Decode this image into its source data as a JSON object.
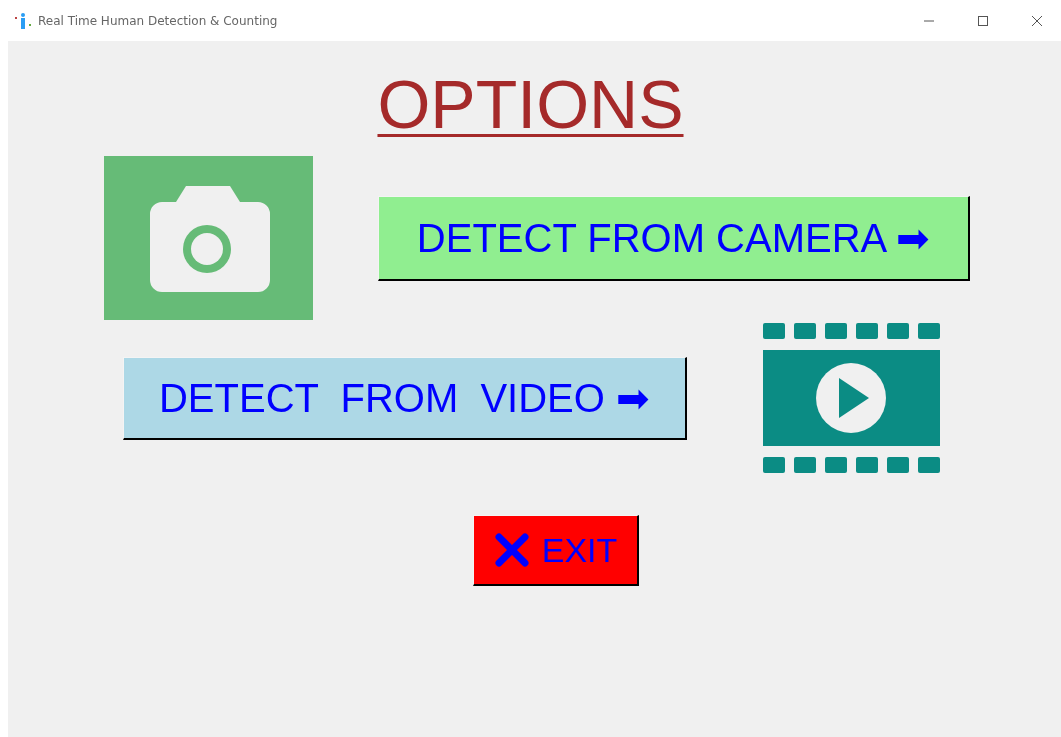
{
  "window": {
    "title": "Real Time Human Detection & Counting"
  },
  "heading": "OPTIONS",
  "buttons": [
    {
      "kind": "camera",
      "label": "DETECT FROM CAMERA ➡"
    },
    {
      "kind": "video",
      "label": "DETECT  FROM  VIDEO ➡"
    },
    {
      "kind": "exit",
      "label": "EXIT"
    }
  ]
}
